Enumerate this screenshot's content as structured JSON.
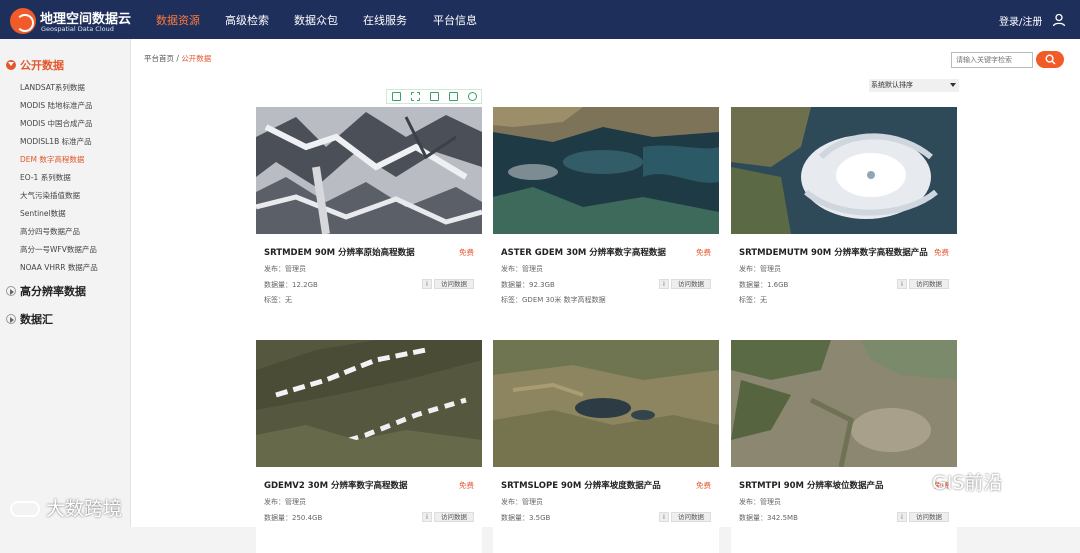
{
  "brand": {
    "name": "地理空间数据云",
    "subtitle": "Geospatial Data Cloud",
    "accent": "#f15a29",
    "nav_bg": "#1f2f5c"
  },
  "nav": [
    {
      "label": "数据资源",
      "active": true
    },
    {
      "label": "高级检索"
    },
    {
      "label": "数据众包"
    },
    {
      "label": "在线服务"
    },
    {
      "label": "平台信息"
    }
  ],
  "header": {
    "login_label": "登录/注册"
  },
  "sidebar": {
    "sections": [
      {
        "label": "公开数据",
        "expanded": true
      },
      {
        "label": "高分辨率数据",
        "expanded": false
      },
      {
        "label": "数据汇",
        "expanded": false
      }
    ],
    "items": [
      {
        "label": "LANDSAT系列数据"
      },
      {
        "label": "MODIS 陆地标准产品"
      },
      {
        "label": "MODIS 中国合成产品"
      },
      {
        "label": "MODISL1B 标准产品"
      },
      {
        "label": "DEM 数字高程数据",
        "active": true
      },
      {
        "label": "EO-1 系列数据"
      },
      {
        "label": "大气污染插值数据"
      },
      {
        "label": "Sentinel数据"
      },
      {
        "label": "高分四号数据产品"
      },
      {
        "label": "高分一号WFV数据产品"
      },
      {
        "label": "NOAA VHRR 数据产品"
      }
    ]
  },
  "breadcrumb": {
    "home": "平台首页",
    "separator": "/",
    "current": "公开数据"
  },
  "search": {
    "placeholder": "请输入关键字检索"
  },
  "sort": {
    "selected": "系统默认排序"
  },
  "cards": [
    {
      "title": "SRTMDEM 90M 分辨率原始高程数据",
      "price": "免费",
      "publisher": "发布：管理员",
      "size": "数据量：12.2GB",
      "tags": "标签：无",
      "info": "i",
      "visit": "访问数据"
    },
    {
      "title": "ASTER GDEM 30M 分辨率数字高程数据",
      "price": "免费",
      "publisher": "发布：管理员",
      "size": "数据量：92.3GB",
      "tags": "标签：GDEM 30米 数字高程数据",
      "info": "i",
      "visit": "访问数据"
    },
    {
      "title": "SRTMDEMUTM 90M 分辨率数字高程数据产品",
      "price": "免费",
      "publisher": "发布：管理员",
      "size": "数据量：1.6GB",
      "tags": "标签：无",
      "info": "i",
      "visit": "访问数据"
    },
    {
      "title": "GDEMV2 30M 分辨率数字高程数据",
      "price": "免费",
      "publisher": "发布：管理员",
      "size": "数据量：250.4GB",
      "info": "i",
      "visit": "访问数据"
    },
    {
      "title": "SRTMSLOPE 90M 分辨率坡度数据产品",
      "price": "免费",
      "publisher": "发布：管理员",
      "size": "数据量：3.5GB",
      "info": "i",
      "visit": "访问数据"
    },
    {
      "title": "SRTMTPI 90M 分辨率坡位数据产品",
      "price": "免费",
      "publisher": "发布：管理员",
      "size": "数据量：342.5MB",
      "info": "i",
      "visit": "访问数据"
    }
  ],
  "watermarks": {
    "left": "大数跨境",
    "right": "GIS前沿"
  }
}
